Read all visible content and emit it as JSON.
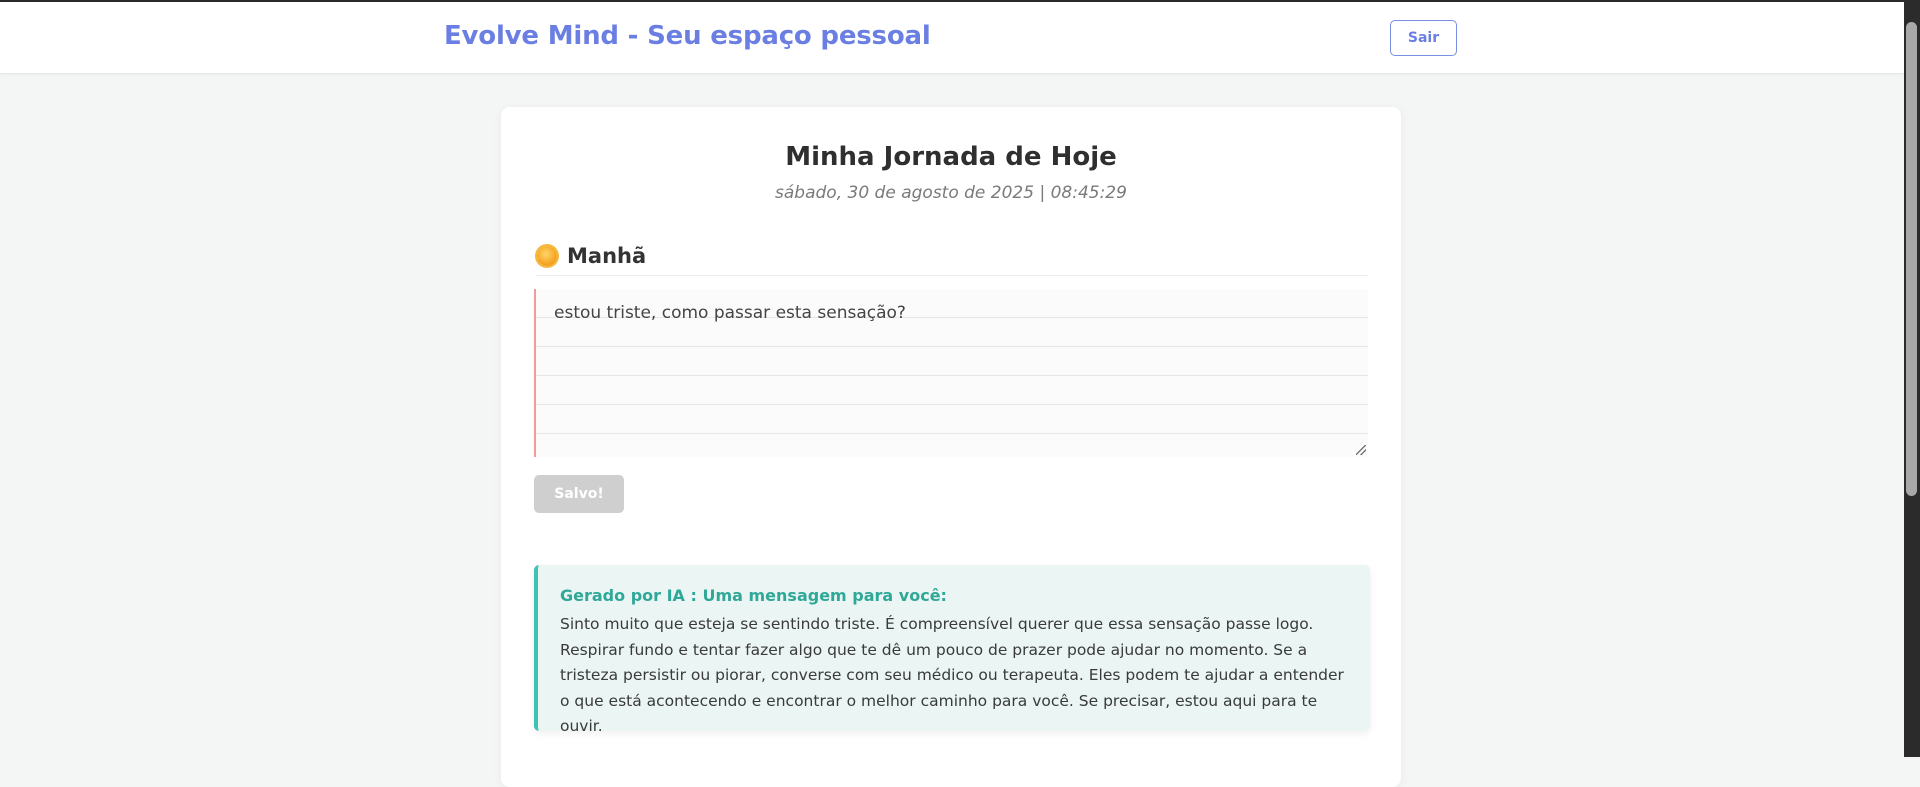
{
  "header": {
    "app_title": "Evolve Mind - Seu espaço pessoal",
    "logout_label": "Sair"
  },
  "page": {
    "title": "Minha Jornada de Hoje",
    "datetime": "sábado, 30 de agosto de 2025 | 08:45:29"
  },
  "section": {
    "icon": "sun-icon",
    "title": "Manhã"
  },
  "entry": {
    "value": "estou triste, como passar esta sensação?"
  },
  "save": {
    "label": "Salvo!"
  },
  "ai_message": {
    "title": "Gerado por IA : Uma mensagem para você:",
    "body": "Sinto muito que esteja se sentindo triste. É compreensível querer que essa sensação passe logo. Respirar fundo e tentar fazer algo que te dê um pouco de prazer pode ajudar no momento. Se a tristeza persistir ou piorar, converse com seu médico ou terapeuta. Eles podem te ajudar a entender o que está acontecendo e encontrar o melhor caminho para você. Se precisar, estou aqui para te ouvir."
  },
  "colors": {
    "brand": "#6b7fe3",
    "accent_teal": "#3cc3b2",
    "margin_line": "#f29a9a",
    "background": "#f4f6f5"
  }
}
